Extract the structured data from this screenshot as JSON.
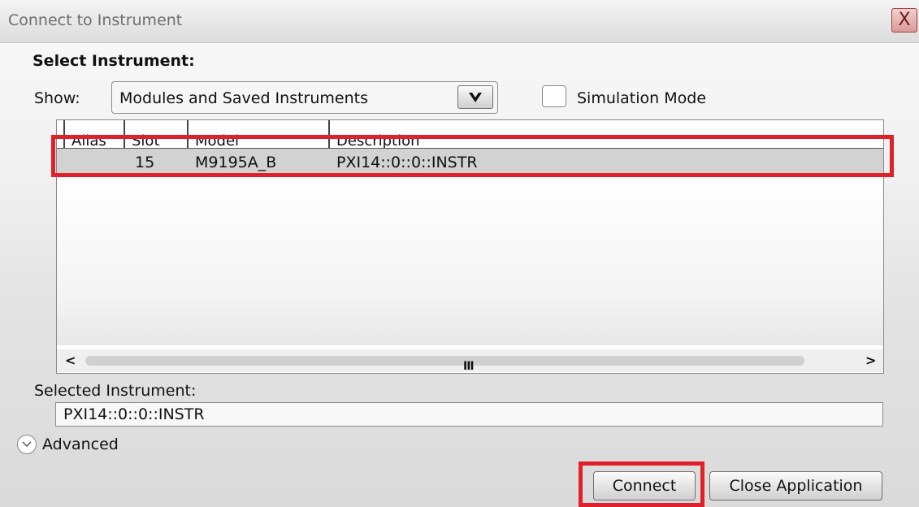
{
  "window": {
    "title": "Connect to Instrument",
    "close_glyph": "X"
  },
  "select_heading": "Select Instrument:",
  "show": {
    "label": "Show:",
    "selected": "Modules and Saved Instruments",
    "dropdown_icon": "chevron-down-icon"
  },
  "simulation": {
    "label": "Simulation Mode",
    "checked": false
  },
  "table": {
    "columns": [
      "Alias",
      "Slot",
      "Model",
      "Description"
    ],
    "rows": [
      {
        "alias": "",
        "slot": "15",
        "model": "M9195A_B",
        "description": "PXI14::0::0::INSTR"
      }
    ],
    "scroll_grip": "III"
  },
  "selected_instrument": {
    "label": "Selected Instrument:",
    "value": "PXI14::0::0::INSTR"
  },
  "advanced": {
    "label": "Advanced",
    "icon": "chevron-down-circle-icon"
  },
  "buttons": {
    "connect": "Connect",
    "close_application": "Close Application"
  },
  "colors": {
    "highlight": "#e0202a",
    "selected_row": "#d2d2d2"
  }
}
